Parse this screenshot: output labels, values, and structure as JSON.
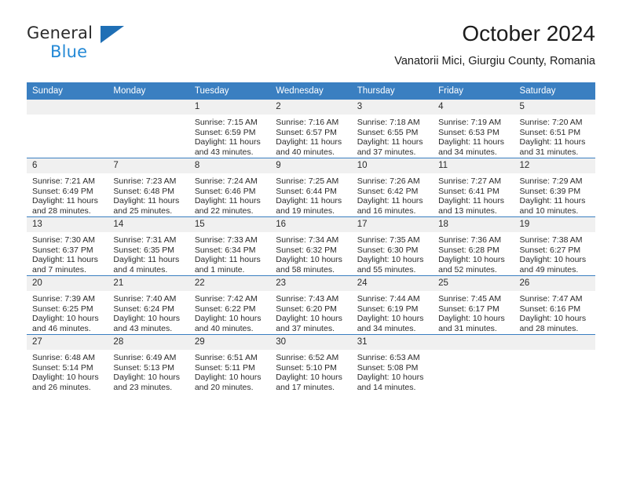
{
  "brand": {
    "name_top": "General",
    "name_bottom": "Blue",
    "triangle_color": "#1f6fb5",
    "blue_text_color": "#2489d6"
  },
  "header": {
    "title": "October 2024",
    "subtitle": "Vanatorii Mici, Giurgiu County, Romania"
  },
  "theme": {
    "header_bg": "#3a7fc1",
    "daynum_bg": "#f0f0f0",
    "text": "#2b2b2b"
  },
  "weekdays": [
    "Sunday",
    "Monday",
    "Tuesday",
    "Wednesday",
    "Thursday",
    "Friday",
    "Saturday"
  ],
  "labels": {
    "sunrise_prefix": "Sunrise:",
    "sunset_prefix": "Sunset:",
    "daylight_prefix": "Daylight:"
  },
  "weeks": [
    [
      {
        "day": "",
        "empty": true
      },
      {
        "day": "",
        "empty": true
      },
      {
        "day": "1",
        "sunrise": "Sunrise: 7:15 AM",
        "sunset": "Sunset: 6:59 PM",
        "daylight1": "Daylight: 11 hours",
        "daylight2": "and 43 minutes."
      },
      {
        "day": "2",
        "sunrise": "Sunrise: 7:16 AM",
        "sunset": "Sunset: 6:57 PM",
        "daylight1": "Daylight: 11 hours",
        "daylight2": "and 40 minutes."
      },
      {
        "day": "3",
        "sunrise": "Sunrise: 7:18 AM",
        "sunset": "Sunset: 6:55 PM",
        "daylight1": "Daylight: 11 hours",
        "daylight2": "and 37 minutes."
      },
      {
        "day": "4",
        "sunrise": "Sunrise: 7:19 AM",
        "sunset": "Sunset: 6:53 PM",
        "daylight1": "Daylight: 11 hours",
        "daylight2": "and 34 minutes."
      },
      {
        "day": "5",
        "sunrise": "Sunrise: 7:20 AM",
        "sunset": "Sunset: 6:51 PM",
        "daylight1": "Daylight: 11 hours",
        "daylight2": "and 31 minutes."
      }
    ],
    [
      {
        "day": "6",
        "sunrise": "Sunrise: 7:21 AM",
        "sunset": "Sunset: 6:49 PM",
        "daylight1": "Daylight: 11 hours",
        "daylight2": "and 28 minutes."
      },
      {
        "day": "7",
        "sunrise": "Sunrise: 7:23 AM",
        "sunset": "Sunset: 6:48 PM",
        "daylight1": "Daylight: 11 hours",
        "daylight2": "and 25 minutes."
      },
      {
        "day": "8",
        "sunrise": "Sunrise: 7:24 AM",
        "sunset": "Sunset: 6:46 PM",
        "daylight1": "Daylight: 11 hours",
        "daylight2": "and 22 minutes."
      },
      {
        "day": "9",
        "sunrise": "Sunrise: 7:25 AM",
        "sunset": "Sunset: 6:44 PM",
        "daylight1": "Daylight: 11 hours",
        "daylight2": "and 19 minutes."
      },
      {
        "day": "10",
        "sunrise": "Sunrise: 7:26 AM",
        "sunset": "Sunset: 6:42 PM",
        "daylight1": "Daylight: 11 hours",
        "daylight2": "and 16 minutes."
      },
      {
        "day": "11",
        "sunrise": "Sunrise: 7:27 AM",
        "sunset": "Sunset: 6:41 PM",
        "daylight1": "Daylight: 11 hours",
        "daylight2": "and 13 minutes."
      },
      {
        "day": "12",
        "sunrise": "Sunrise: 7:29 AM",
        "sunset": "Sunset: 6:39 PM",
        "daylight1": "Daylight: 11 hours",
        "daylight2": "and 10 minutes."
      }
    ],
    [
      {
        "day": "13",
        "sunrise": "Sunrise: 7:30 AM",
        "sunset": "Sunset: 6:37 PM",
        "daylight1": "Daylight: 11 hours",
        "daylight2": "and 7 minutes."
      },
      {
        "day": "14",
        "sunrise": "Sunrise: 7:31 AM",
        "sunset": "Sunset: 6:35 PM",
        "daylight1": "Daylight: 11 hours",
        "daylight2": "and 4 minutes."
      },
      {
        "day": "15",
        "sunrise": "Sunrise: 7:33 AM",
        "sunset": "Sunset: 6:34 PM",
        "daylight1": "Daylight: 11 hours",
        "daylight2": "and 1 minute."
      },
      {
        "day": "16",
        "sunrise": "Sunrise: 7:34 AM",
        "sunset": "Sunset: 6:32 PM",
        "daylight1": "Daylight: 10 hours",
        "daylight2": "and 58 minutes."
      },
      {
        "day": "17",
        "sunrise": "Sunrise: 7:35 AM",
        "sunset": "Sunset: 6:30 PM",
        "daylight1": "Daylight: 10 hours",
        "daylight2": "and 55 minutes."
      },
      {
        "day": "18",
        "sunrise": "Sunrise: 7:36 AM",
        "sunset": "Sunset: 6:28 PM",
        "daylight1": "Daylight: 10 hours",
        "daylight2": "and 52 minutes."
      },
      {
        "day": "19",
        "sunrise": "Sunrise: 7:38 AM",
        "sunset": "Sunset: 6:27 PM",
        "daylight1": "Daylight: 10 hours",
        "daylight2": "and 49 minutes."
      }
    ],
    [
      {
        "day": "20",
        "sunrise": "Sunrise: 7:39 AM",
        "sunset": "Sunset: 6:25 PM",
        "daylight1": "Daylight: 10 hours",
        "daylight2": "and 46 minutes."
      },
      {
        "day": "21",
        "sunrise": "Sunrise: 7:40 AM",
        "sunset": "Sunset: 6:24 PM",
        "daylight1": "Daylight: 10 hours",
        "daylight2": "and 43 minutes."
      },
      {
        "day": "22",
        "sunrise": "Sunrise: 7:42 AM",
        "sunset": "Sunset: 6:22 PM",
        "daylight1": "Daylight: 10 hours",
        "daylight2": "and 40 minutes."
      },
      {
        "day": "23",
        "sunrise": "Sunrise: 7:43 AM",
        "sunset": "Sunset: 6:20 PM",
        "daylight1": "Daylight: 10 hours",
        "daylight2": "and 37 minutes."
      },
      {
        "day": "24",
        "sunrise": "Sunrise: 7:44 AM",
        "sunset": "Sunset: 6:19 PM",
        "daylight1": "Daylight: 10 hours",
        "daylight2": "and 34 minutes."
      },
      {
        "day": "25",
        "sunrise": "Sunrise: 7:45 AM",
        "sunset": "Sunset: 6:17 PM",
        "daylight1": "Daylight: 10 hours",
        "daylight2": "and 31 minutes."
      },
      {
        "day": "26",
        "sunrise": "Sunrise: 7:47 AM",
        "sunset": "Sunset: 6:16 PM",
        "daylight1": "Daylight: 10 hours",
        "daylight2": "and 28 minutes."
      }
    ],
    [
      {
        "day": "27",
        "sunrise": "Sunrise: 6:48 AM",
        "sunset": "Sunset: 5:14 PM",
        "daylight1": "Daylight: 10 hours",
        "daylight2": "and 26 minutes."
      },
      {
        "day": "28",
        "sunrise": "Sunrise: 6:49 AM",
        "sunset": "Sunset: 5:13 PM",
        "daylight1": "Daylight: 10 hours",
        "daylight2": "and 23 minutes."
      },
      {
        "day": "29",
        "sunrise": "Sunrise: 6:51 AM",
        "sunset": "Sunset: 5:11 PM",
        "daylight1": "Daylight: 10 hours",
        "daylight2": "and 20 minutes."
      },
      {
        "day": "30",
        "sunrise": "Sunrise: 6:52 AM",
        "sunset": "Sunset: 5:10 PM",
        "daylight1": "Daylight: 10 hours",
        "daylight2": "and 17 minutes."
      },
      {
        "day": "31",
        "sunrise": "Sunrise: 6:53 AM",
        "sunset": "Sunset: 5:08 PM",
        "daylight1": "Daylight: 10 hours",
        "daylight2": "and 14 minutes."
      },
      {
        "day": "",
        "empty": true
      },
      {
        "day": "",
        "empty": true
      }
    ]
  ]
}
